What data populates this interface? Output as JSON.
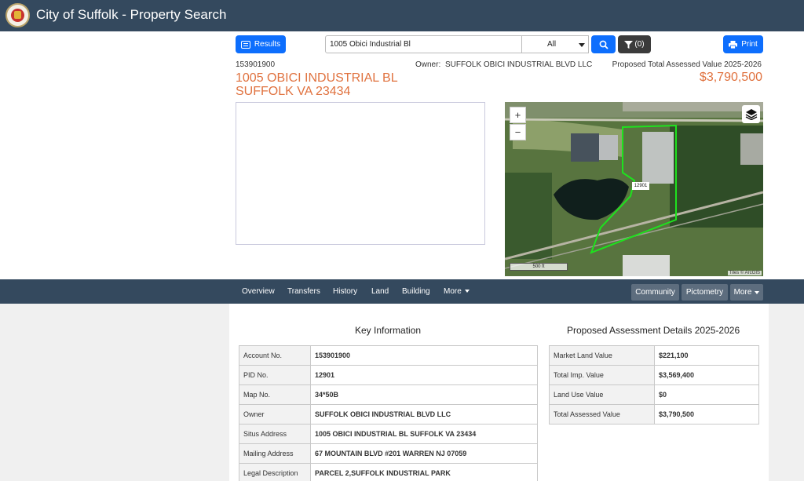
{
  "app": {
    "title": "City of Suffolk - Property Search"
  },
  "toolbar": {
    "results_label": "Results",
    "search_value": "1005 Obici Industrial Bl",
    "filter_selected": "All",
    "filter_count": "(0)",
    "print_label": "Print"
  },
  "property": {
    "account": "153901900",
    "address_line1": "1005 OBICI INDUSTRIAL BL",
    "address_line2": "SUFFOLK VA 23434",
    "owner_label": "Owner:",
    "owner": "SUFFOLK OBICI INDUSTRIAL BLVD LLC",
    "value_label": "Proposed Total Assessed Value 2025-2026",
    "value": "$3,790,500"
  },
  "map": {
    "zoom_in": "+",
    "zoom_out": "−",
    "parcel_label": "12901",
    "scale": "500 ft",
    "attribution": "Tiles © ArcGIS"
  },
  "nav": {
    "tabs": [
      "Overview",
      "Transfers",
      "History",
      "Land",
      "Building",
      "More"
    ],
    "right_buttons": [
      "Community",
      "Pictometry",
      "More"
    ]
  },
  "key_info": {
    "title": "Key Information",
    "rows": [
      {
        "label": "Account No.",
        "value": "153901900"
      },
      {
        "label": "PID No.",
        "value": "12901"
      },
      {
        "label": "Map No.",
        "value": "34*50B"
      },
      {
        "label": "Owner",
        "value": "SUFFOLK OBICI INDUSTRIAL BLVD LLC"
      },
      {
        "label": "Situs Address",
        "value": "1005 OBICI INDUSTRIAL BL SUFFOLK VA 23434"
      },
      {
        "label": "Mailing Address",
        "value": "67 MOUNTAIN BLVD #201 WARREN NJ 07059"
      },
      {
        "label": "Legal Description",
        "value": "PARCEL 2,SUFFOLK INDUSTRIAL PARK"
      }
    ]
  },
  "assessment": {
    "title": "Proposed Assessment Details 2025-2026",
    "rows": [
      {
        "label": "Market Land Value",
        "value": "$221,100"
      },
      {
        "label": "Total Imp. Value",
        "value": "$3,569,400"
      },
      {
        "label": "Land Use Value",
        "value": "$0"
      },
      {
        "label": "Total Assessed Value",
        "value": "$3,790,500"
      }
    ]
  },
  "colors": {
    "header_bg": "#34495e",
    "accent_orange": "#e0723f",
    "primary_blue": "#0d6efd"
  }
}
